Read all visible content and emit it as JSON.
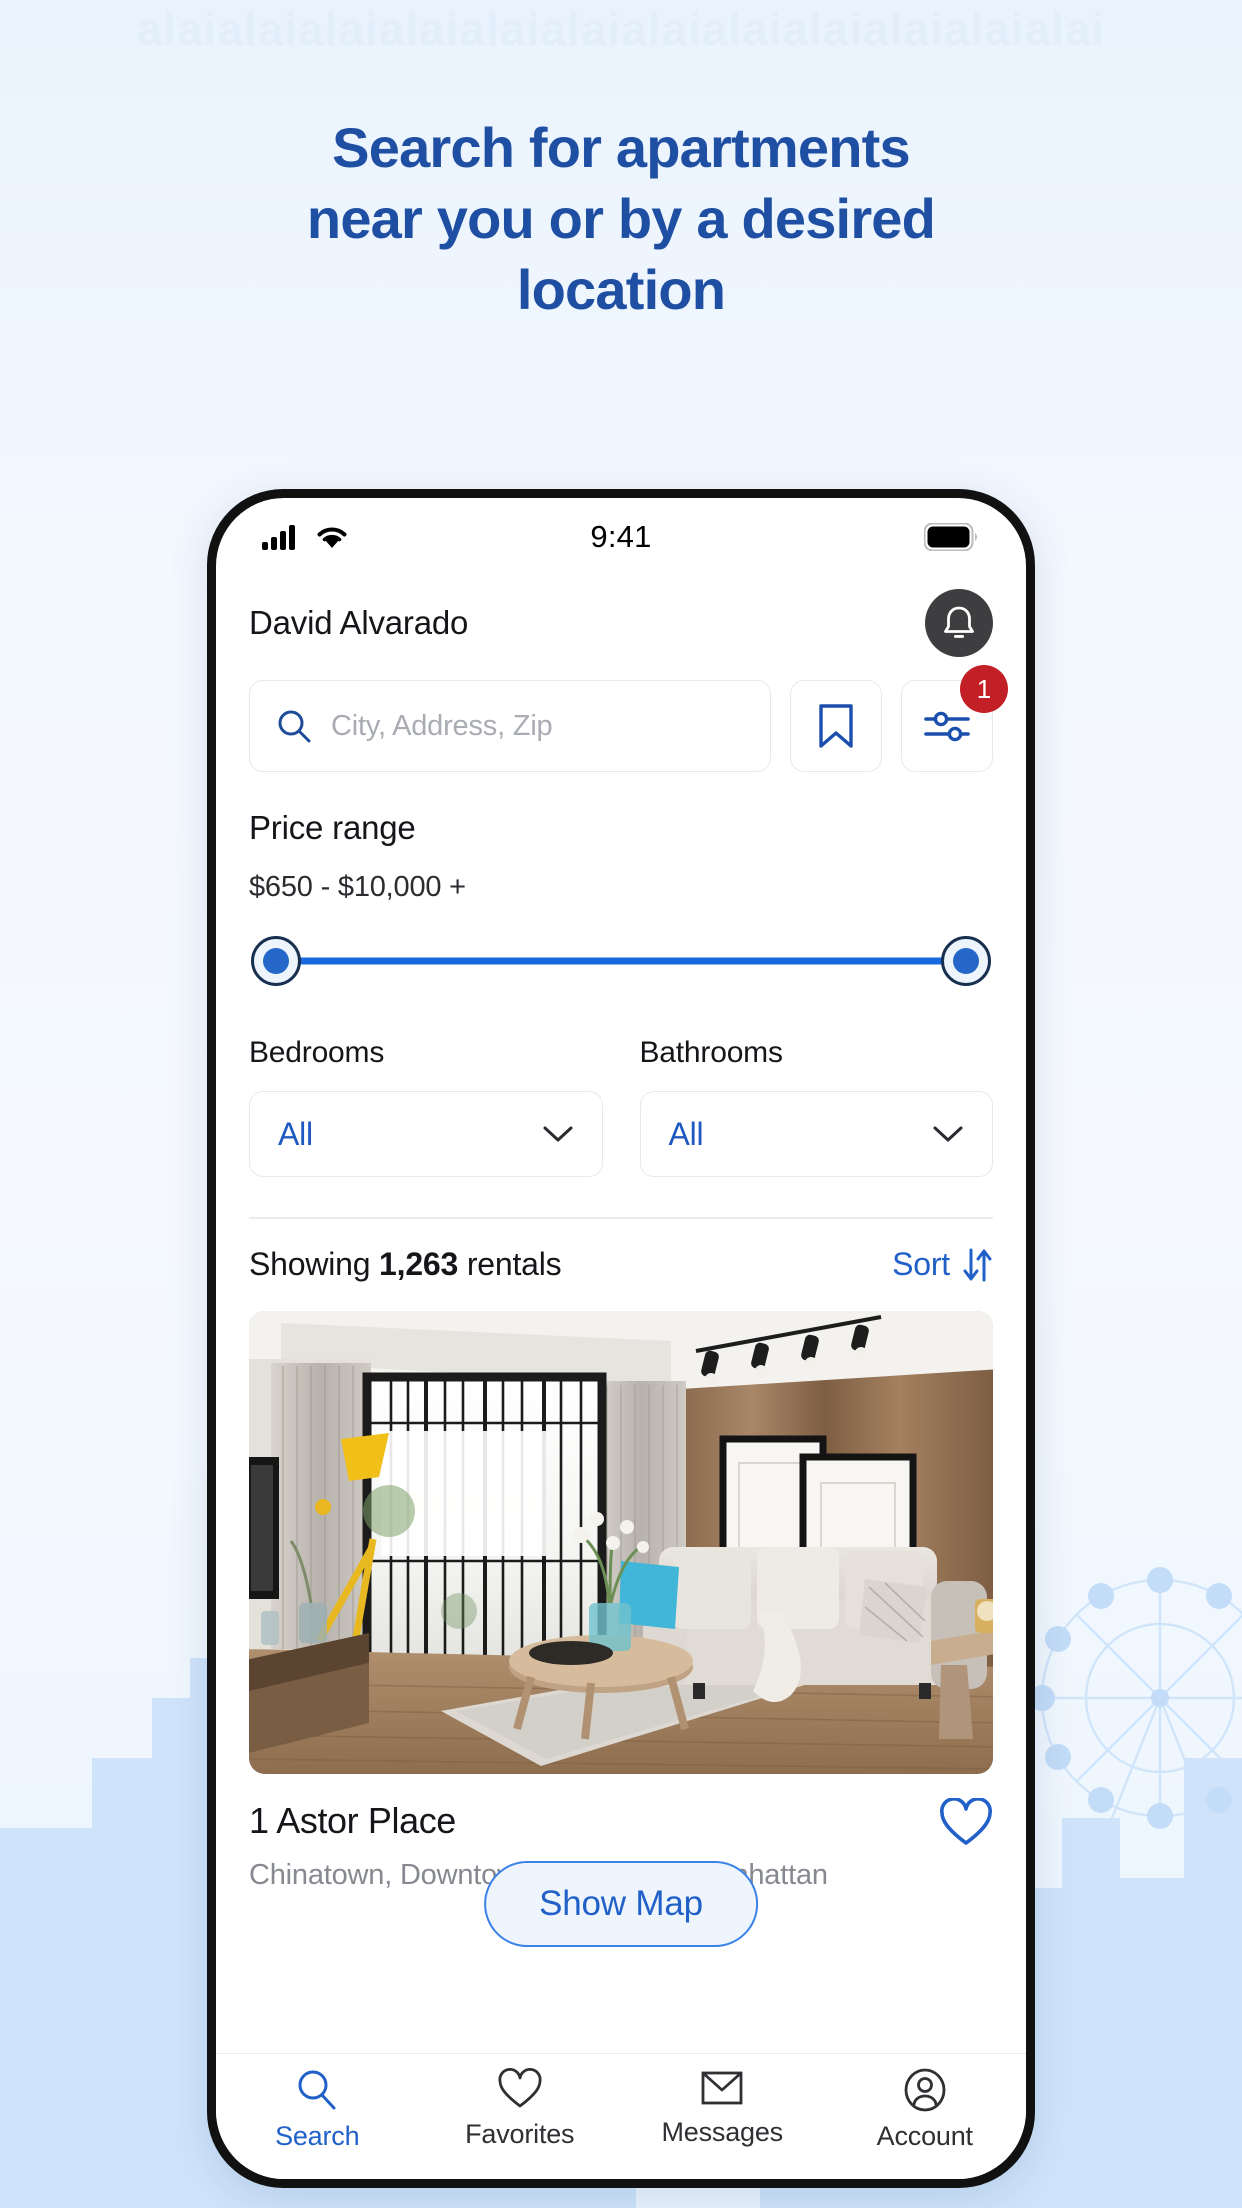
{
  "background": {
    "ghost_text": "alaialaialaialaialaialaialaialaialaialaialaialai",
    "accent_blue": "#1f4fa3",
    "skyline_color": "#cfe4fa",
    "page_bg": "#eef5fd"
  },
  "headline": {
    "line1": "Search for apartments",
    "line2": "near you or by a desired",
    "line3": "location"
  },
  "statusbar": {
    "time": "9:41",
    "signal_icon": "cellular-signal-icon",
    "wifi_icon": "wifi-icon",
    "battery_icon": "battery-full-icon"
  },
  "appheader": {
    "username": "David Alvarado",
    "bell_icon": "bell-icon"
  },
  "search": {
    "placeholder": "City, Address, Zip",
    "value": "",
    "search_icon": "search-icon",
    "bookmark_icon": "bookmark-icon",
    "filter_icon": "sliders-filter-icon",
    "filter_badge": "1"
  },
  "filters": {
    "price_label": "Price range",
    "price_value": "$650 - $10,000 +",
    "slider": {
      "min_pos_pct": 0,
      "max_pos_pct": 100
    },
    "bedrooms": {
      "label": "Bedrooms",
      "value": "All",
      "chevron_icon": "chevron-down-icon"
    },
    "bathrooms": {
      "label": "Bathrooms",
      "value": "All",
      "chevron_icon": "chevron-down-icon"
    }
  },
  "results": {
    "showing_prefix": "Showing ",
    "count": "1,263",
    "showing_suffix": " rentals",
    "sort_label": "Sort",
    "sort_icon": "sort-arrows-icon"
  },
  "listing": {
    "title": "1 Astor Place",
    "address": "Chinatown, Downtown Manhattan, Manhattan",
    "photo_alt": "living-room-photo",
    "favorite_icon": "heart-outline-icon"
  },
  "show_map": {
    "label": "Show Map"
  },
  "tabbar": {
    "items": [
      {
        "label": "Search",
        "icon": "search-icon",
        "active": true
      },
      {
        "label": "Favorites",
        "icon": "heart-outline-icon",
        "active": false
      },
      {
        "label": "Messages",
        "icon": "envelope-icon",
        "active": false
      },
      {
        "label": "Account",
        "icon": "user-circle-icon",
        "active": false
      }
    ]
  }
}
